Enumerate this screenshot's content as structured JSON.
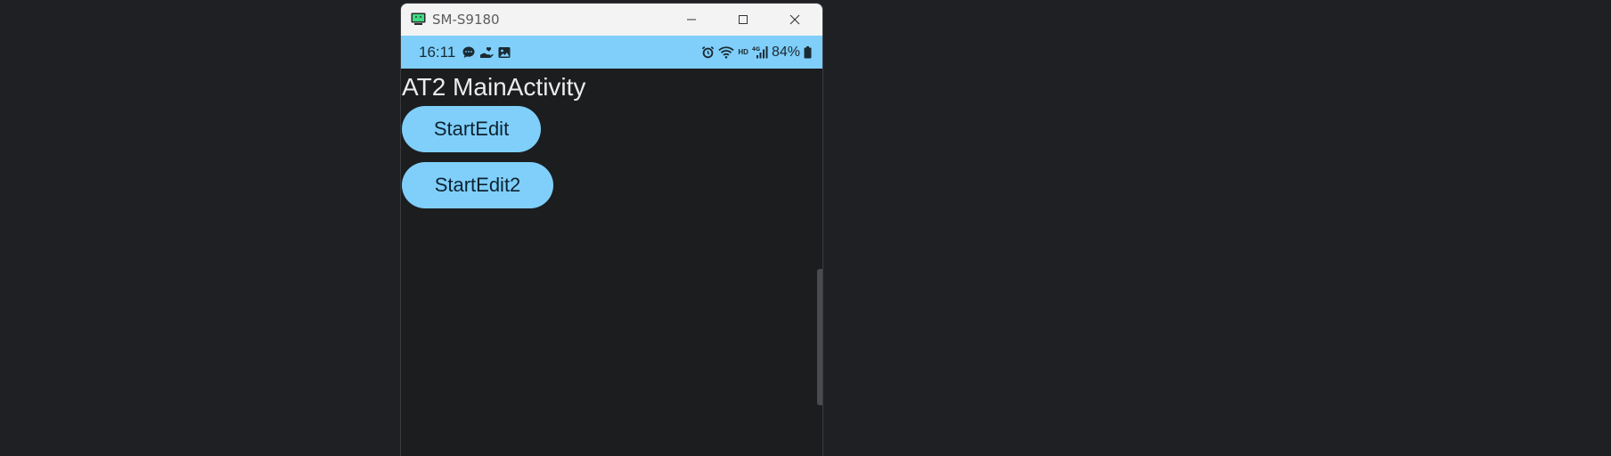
{
  "window": {
    "title": "SM-S9180",
    "minimize_icon": "minimize-icon",
    "maximize_icon": "maximize-icon",
    "close_icon": "close-icon"
  },
  "status_bar": {
    "time": "16:11",
    "notification_icons": [
      "chat-bubble-icon",
      "hand-heart-icon",
      "image-icon"
    ],
    "system_icons": [
      "alarm-icon",
      "wifi-icon",
      "hd-icon",
      "4g-signal-icon",
      "battery-icon"
    ],
    "hd_label": "HD",
    "battery_percent": "84%"
  },
  "activity": {
    "title": "AT2 MainActivity",
    "buttons": [
      {
        "label": "StartEdit"
      },
      {
        "label": "StartEdit2"
      }
    ]
  },
  "colors": {
    "accent": "#7fcffa",
    "background": "#1c1d1f",
    "desktop": "#1f2023",
    "titlebar": "#f3f3f3"
  }
}
